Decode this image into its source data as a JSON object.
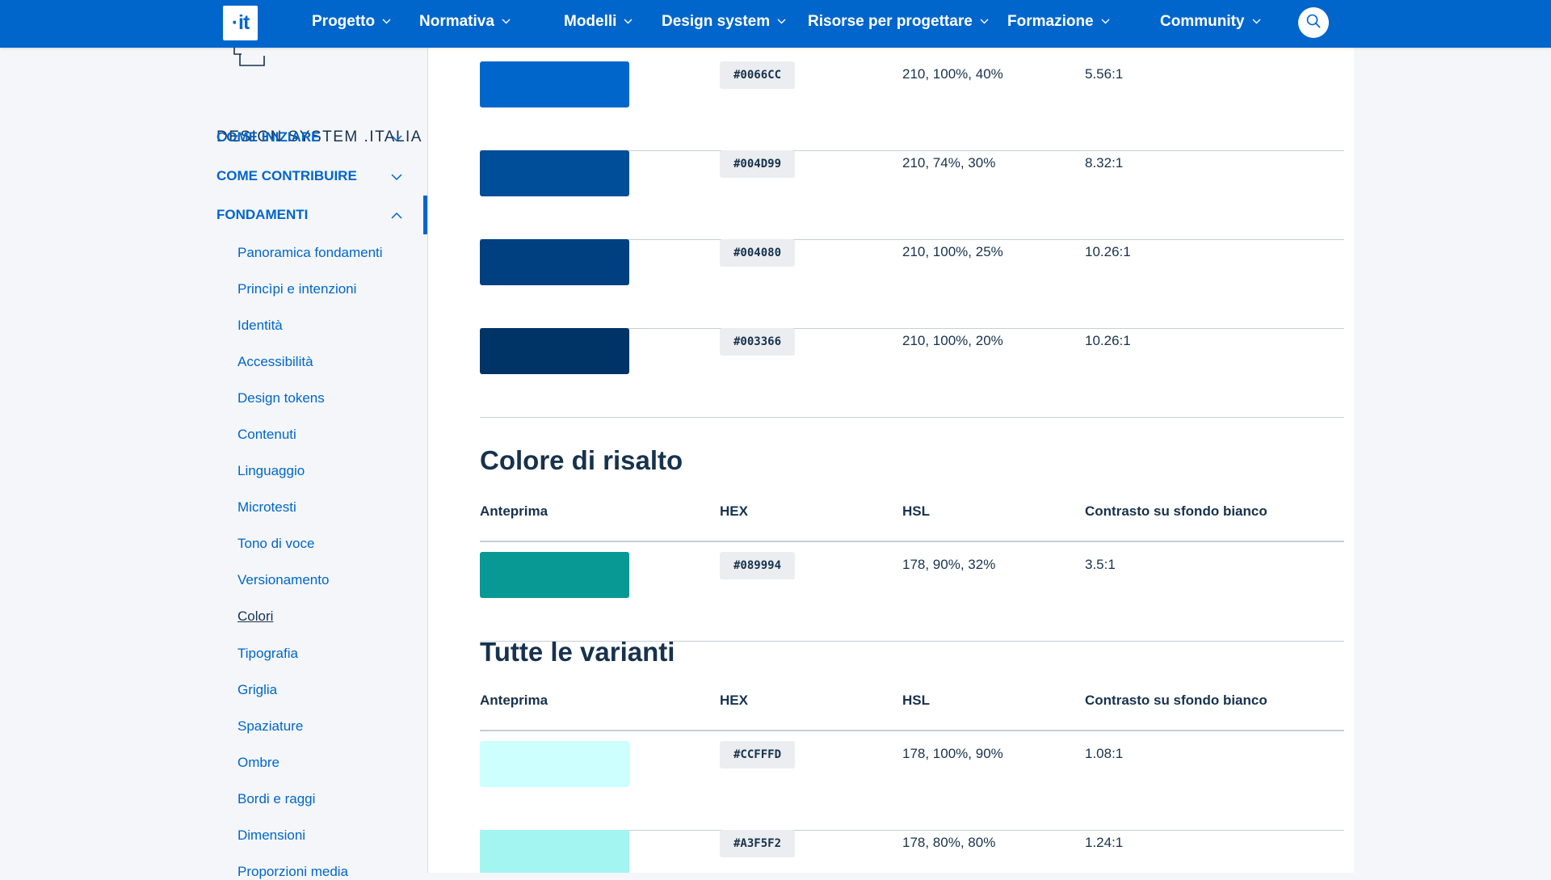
{
  "header": {
    "logo_text": "it",
    "nav": [
      {
        "label": "Progetto"
      },
      {
        "label": "Normativa"
      },
      {
        "label": "Modelli"
      },
      {
        "label": "Design system"
      },
      {
        "label": "Risorse per progettare"
      },
      {
        "label": "Formazione"
      },
      {
        "label": "Community"
      }
    ],
    "search_icon": "search-icon"
  },
  "sidebar": {
    "title": "DESIGN SYSTEM .ITALIA",
    "sections": [
      {
        "label": "COME INIZIARE",
        "expanded": false
      },
      {
        "label": "COME CONTRIBUIRE",
        "expanded": false
      },
      {
        "label": "FONDAMENTI",
        "expanded": true
      }
    ],
    "items": [
      {
        "label": "Panoramica fondamenti"
      },
      {
        "label": "Princìpi e intenzioni"
      },
      {
        "label": "Identità"
      },
      {
        "label": "Accessibilità"
      },
      {
        "label": "Design tokens"
      },
      {
        "label": "Contenuti"
      },
      {
        "label": "Linguaggio"
      },
      {
        "label": "Microtesti"
      },
      {
        "label": "Tono di voce"
      },
      {
        "label": "Versionamento"
      },
      {
        "label": "Colori"
      },
      {
        "label": "Tipografia"
      },
      {
        "label": "Griglia"
      },
      {
        "label": "Spaziature"
      },
      {
        "label": "Ombre"
      },
      {
        "label": "Bordi e raggi"
      },
      {
        "label": "Dimensioni"
      },
      {
        "label": "Proporzioni media"
      }
    ],
    "current_item": "Colori"
  },
  "main": {
    "primary_rows": [
      {
        "hex": "#0066CC",
        "hsl": "210, 100%, 40%",
        "contrast": "5.56:1",
        "color": "#0066cc"
      },
      {
        "hex": "#004D99",
        "hsl": "210, 74%, 30%",
        "contrast": "8.32:1",
        "color": "#004d99"
      },
      {
        "hex": "#004080",
        "hsl": "210, 100%, 25%",
        "contrast": "10.26:1",
        "color": "#004080"
      },
      {
        "hex": "#003366",
        "hsl": "210, 100%, 20%",
        "contrast": "10.26:1",
        "color": "#003366"
      }
    ],
    "accent": {
      "title": "Colore di risalto",
      "headers": {
        "preview": "Anteprima",
        "hex": "HEX",
        "hsl": "HSL",
        "contrast": "Contrasto su sfondo bianco"
      },
      "rows": [
        {
          "hex": "#089994",
          "hsl": "178, 90%, 32%",
          "contrast": "3.5:1",
          "color": "#089994"
        }
      ]
    },
    "variants": {
      "title": "Tutte le varianti",
      "headers": {
        "preview": "Anteprima",
        "hex": "HEX",
        "hsl": "HSL",
        "contrast": "Contrasto su sfondo bianco"
      },
      "rows": [
        {
          "hex": "#CCFFFD",
          "hsl": "178, 100%, 90%",
          "contrast": "1.08:1",
          "color": "#ccfffd"
        },
        {
          "hex": "#A3F5F2",
          "hsl": "178, 80%, 80%",
          "contrast": "1.24:1",
          "color": "#a3f5f2"
        }
      ]
    }
  }
}
